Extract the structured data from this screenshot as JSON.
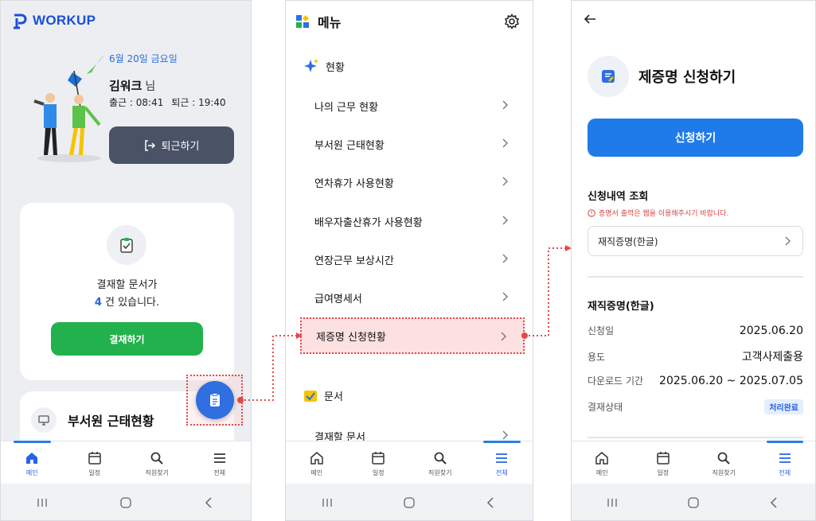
{
  "screen1": {
    "logo_text": "WORKUP",
    "date": "6월 20일 금요일",
    "user_name": "김워크",
    "user_suffix": "님",
    "clock_in": "출근 : 08:41",
    "clock_out_time": "퇴근 : 19:40",
    "clock_out_button": "퇴근하기",
    "approval_line1": "결재할 문서가",
    "approval_count": "4",
    "approval_line2_suffix": " 건 있습니다.",
    "approve_button": "결재하기",
    "dept_card_title": "부서원 근태현황",
    "nav": [
      {
        "label": "메인",
        "icon": "home-icon",
        "active": true
      },
      {
        "label": "일정",
        "icon": "calendar-icon",
        "active": false
      },
      {
        "label": "직원찾기",
        "icon": "search-icon",
        "active": false
      },
      {
        "label": "전체",
        "icon": "menu-icon",
        "active": false
      }
    ]
  },
  "screen2": {
    "title": "메뉴",
    "section_status": "현황",
    "items": [
      {
        "label": "나의 근무 현황"
      },
      {
        "label": "부서원 근태현황"
      },
      {
        "label": "연차휴가 사용현황"
      },
      {
        "label": "배우자출산휴가 사용현황"
      },
      {
        "label": "연장근무 보상시간"
      },
      {
        "label": "급여명세서"
      },
      {
        "label": "제증명 신청현황",
        "highlighted": true
      }
    ],
    "section_docs": "문서",
    "doc_items": [
      {
        "label": "결재할 문서"
      }
    ],
    "nav": [
      {
        "label": "메인",
        "icon": "home-icon",
        "active": false
      },
      {
        "label": "일정",
        "icon": "calendar-icon",
        "active": false
      },
      {
        "label": "직원찾기",
        "icon": "search-icon",
        "active": false
      },
      {
        "label": "전체",
        "icon": "menu-icon",
        "active": true
      }
    ]
  },
  "screen3": {
    "title": "제증명 신청하기",
    "apply_button": "신청하기",
    "inquiry_heading": "신청내역 조회",
    "warning": "증명서 출력은 웹을 이용해주시기 바랍니다.",
    "select_value": "재직증명(한글)",
    "detail_heading": "재직증명(한글)",
    "details": [
      {
        "label": "신청일",
        "value": "2025.06.20"
      },
      {
        "label": "용도",
        "value": "고객사제출용"
      },
      {
        "label": "다운로드 기간",
        "value": "2025.06.20 ~ 2025.07.05"
      }
    ],
    "status_label": "결재상태",
    "status_badge": "처리완료",
    "nav": [
      {
        "label": "메인",
        "icon": "home-icon",
        "active": false
      },
      {
        "label": "일정",
        "icon": "calendar-icon",
        "active": false
      },
      {
        "label": "직원찾기",
        "icon": "search-icon",
        "active": false
      },
      {
        "label": "전체",
        "icon": "menu-icon",
        "active": true
      }
    ]
  },
  "colors": {
    "brand_blue": "#2f6fe0",
    "green": "#22b14c",
    "highlight_red": "#e54848",
    "dark_button": "#4a5266"
  }
}
